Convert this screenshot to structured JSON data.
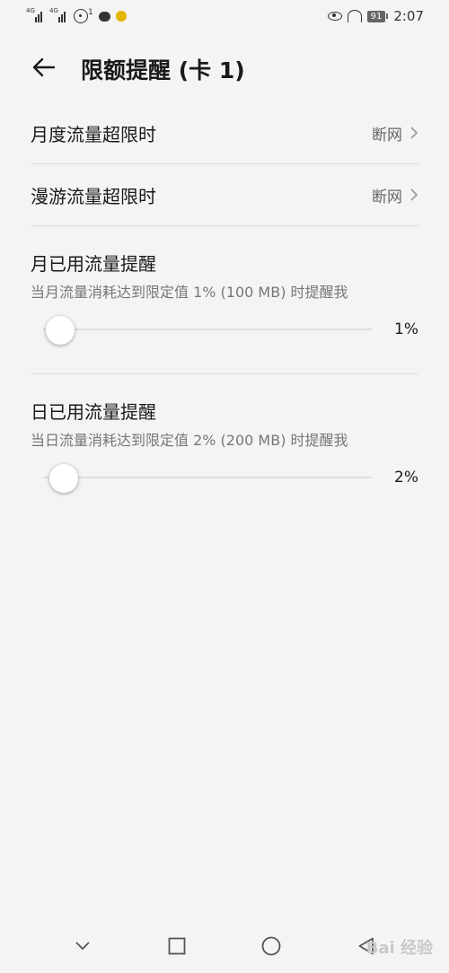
{
  "status_bar": {
    "time": "2:07",
    "battery": "91",
    "signal_tag": "4G",
    "hotspot_badge": "1"
  },
  "header": {
    "title": "限额提醒 (卡 1)"
  },
  "settings": [
    {
      "label": "月度流量超限时",
      "value": "断网"
    },
    {
      "label": "漫游流量超限时",
      "value": "断网"
    }
  ],
  "reminders": [
    {
      "title": "月已用流量提醒",
      "desc": "当月流量消耗达到限定值 1% (100 MB) 时提醒我",
      "percent": "1%",
      "level": 1
    },
    {
      "title": "日已用流量提醒",
      "desc": "当日流量消耗达到限定值 2% (200 MB) 时提醒我",
      "percent": "2%",
      "level": 2
    }
  ],
  "watermark": "Bai 经验",
  "icons": [
    "back-arrow-icon",
    "chevron-right-icon",
    "nav-down-icon",
    "nav-recents-icon",
    "nav-home-icon",
    "nav-back-icon"
  ]
}
